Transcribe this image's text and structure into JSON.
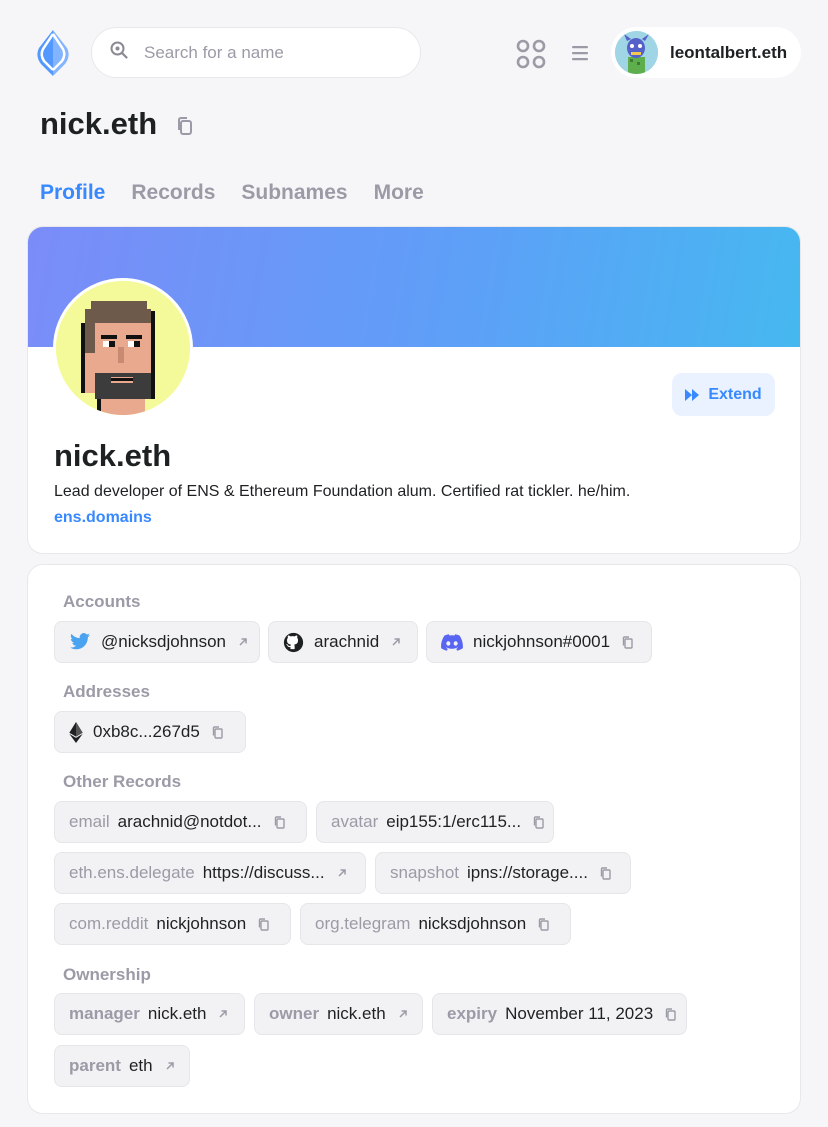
{
  "header": {
    "search_placeholder": "Search for a name",
    "account_name": "leontalbert.eth"
  },
  "page": {
    "title": "nick.eth"
  },
  "tabs": [
    {
      "label": "Profile",
      "active": true
    },
    {
      "label": "Records",
      "active": false
    },
    {
      "label": "Subnames",
      "active": false
    },
    {
      "label": "More",
      "active": false
    }
  ],
  "profile": {
    "name": "nick.eth",
    "bio": "Lead developer of ENS & Ethereum Foundation alum. Certified rat tickler. he/him.",
    "website": "ens.domains",
    "extend_label": "Extend"
  },
  "sections": {
    "accounts": "Accounts",
    "addresses": "Addresses",
    "other_records": "Other Records",
    "ownership": "Ownership"
  },
  "accounts": [
    {
      "icon": "twitter-icon",
      "value": "@nicksdjohnson"
    },
    {
      "icon": "github-icon",
      "value": "arachnid"
    },
    {
      "icon": "discord-icon",
      "value": "nickjohnson#0001"
    }
  ],
  "addresses": [
    {
      "icon": "ethereum-icon",
      "value": "0xb8c...267d5"
    }
  ],
  "other_records": [
    {
      "key": "email",
      "value": "arachnid@notdot..."
    },
    {
      "key": "avatar",
      "value": "eip155:1/erc115..."
    },
    {
      "key": "eth.ens.delegate",
      "value": "https://discuss..."
    },
    {
      "key": "snapshot",
      "value": "ipns://storage...."
    },
    {
      "key": "com.reddit",
      "value": "nickjohnson"
    },
    {
      "key": "org.telegram",
      "value": "nicksdjohnson"
    }
  ],
  "ownership": [
    {
      "key": "manager",
      "value": "nick.eth"
    },
    {
      "key": "owner",
      "value": "nick.eth"
    },
    {
      "key": "expiry",
      "value": "November 11, 2023"
    },
    {
      "key": "parent",
      "value": "eth"
    }
  ],
  "colors": {
    "accent": "#3889ff",
    "muted_text": "#9b9ba7",
    "background": "#f6f6f8"
  }
}
